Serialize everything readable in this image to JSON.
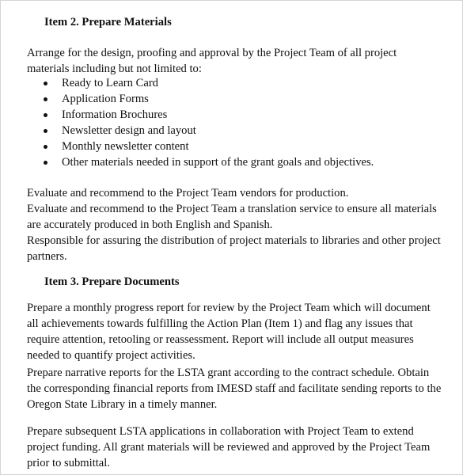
{
  "document": {
    "sections": [
      {
        "heading": "Item 2. Prepare Materials",
        "intro_lines": [
          "Arrange for the design, proofing and approval by the Project Team of all project",
          "materials including but not limited to:"
        ],
        "bullets": [
          "Ready to Learn Card",
          "Application Forms",
          "Information Brochures",
          "Newsletter design and layout",
          "Monthly newsletter content",
          "Other materials needed in support of the grant goals and objectives."
        ],
        "paragraph_lines": [
          "Evaluate and recommend to the Project Team vendors for production.",
          "Evaluate and recommend to the Project Team a translation service to ensure all materials",
          "are accurately produced in both English and Spanish.",
          "Responsible for assuring the distribution of project materials to libraries and other project",
          "partners."
        ]
      },
      {
        "heading": "Item 3. Prepare Documents",
        "paragraphs": [
          [
            "Prepare a monthly progress report for review by the Project Team which will document",
            "all achievements towards fulfilling the Action Plan (Item 1) and flag any issues that",
            "require attention, retooling or reassessment.  Report will include all output measures",
            "needed to quantify project activities."
          ],
          [
            "Prepare narrative reports for the LSTA grant according to the contract schedule.  Obtain",
            "the corresponding financial reports from IMESD staff and facilitate sending reports to the",
            "Oregon State Library in a timely manner."
          ],
          [
            "Prepare subsequent LSTA applications in collaboration with Project Team to extend",
            "project funding.  All grant materials will be reviewed and approved by the Project Team",
            "prior to submittal."
          ]
        ]
      }
    ]
  }
}
